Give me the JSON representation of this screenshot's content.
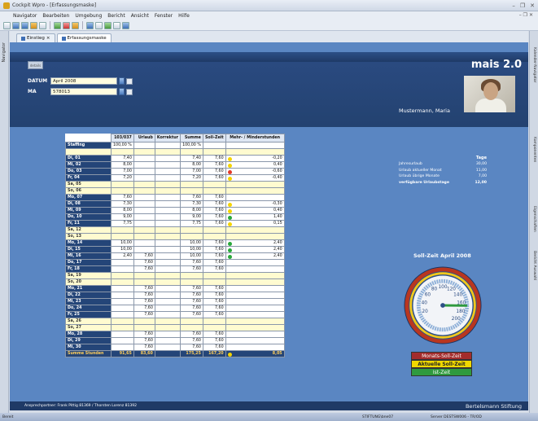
{
  "window": {
    "title": "Cockpit Wpro - [Erfassungsmaske]"
  },
  "menu": [
    "Navigator",
    "Bearbeiten",
    "Umgebung",
    "Bericht",
    "Ansicht",
    "Fenster",
    "Hilfe"
  ],
  "left_panel": {
    "label": "Navigator"
  },
  "right_panel": [
    "Kalender-Navigator",
    "Komponenten",
    "Eigenschaften",
    "Bericht Auswahl"
  ],
  "tabs": [
    {
      "label": "Einstieg"
    },
    {
      "label": "Erfassungsmaske"
    }
  ],
  "header": {
    "details_button": "details",
    "datum_label": "DATUM",
    "datum_value": "April 2008",
    "ma_label": "MA",
    "ma_value": "578013",
    "brand": "mais 2.0",
    "user_name": "Mustermann, Maria"
  },
  "table": {
    "columns": [
      "103/037",
      "Urlaub",
      "Korrektur",
      "Summe",
      "Soll-Zeit",
      "Mehr- / Minderstunden"
    ],
    "staffing": {
      "label": "Staffing",
      "c1": "100,00 %",
      "c4": "100,00 %"
    },
    "rows": [
      {
        "day": "Di, 01",
        "c1": "7,40",
        "c2": "",
        "c3": "",
        "c4": "7,40",
        "c5": "7,60",
        "status": "y",
        "c6": "-0,20",
        "we": false
      },
      {
        "day": "Mi, 02",
        "c1": "8,00",
        "c2": "",
        "c3": "",
        "c4": "8,00",
        "c5": "7,60",
        "status": "y",
        "c6": "0,40",
        "we": false
      },
      {
        "day": "Do, 03",
        "c1": "7,00",
        "c2": "",
        "c3": "",
        "c4": "7,00",
        "c5": "7,60",
        "status": "r",
        "c6": "-0,60",
        "we": false
      },
      {
        "day": "Fr, 04",
        "c1": "7,20",
        "c2": "",
        "c3": "",
        "c4": "7,20",
        "c5": "7,60",
        "status": "y",
        "c6": "-0,40",
        "we": false
      },
      {
        "day": "Sa, 05",
        "c1": "",
        "c2": "",
        "c3": "",
        "c4": "",
        "c5": "",
        "status": "",
        "c6": "",
        "we": true
      },
      {
        "day": "So, 06",
        "c1": "",
        "c2": "",
        "c3": "",
        "c4": "",
        "c5": "",
        "status": "",
        "c6": "",
        "we": true
      },
      {
        "day": "Mo, 07",
        "c1": "7,60",
        "c2": "",
        "c3": "",
        "c4": "7,60",
        "c5": "7,60",
        "status": "",
        "c6": "",
        "we": false
      },
      {
        "day": "Di, 08",
        "c1": "7,30",
        "c2": "",
        "c3": "",
        "c4": "7,30",
        "c5": "7,60",
        "status": "y",
        "c6": "-0,30",
        "we": false
      },
      {
        "day": "Mi, 09",
        "c1": "8,00",
        "c2": "",
        "c3": "",
        "c4": "8,00",
        "c5": "7,60",
        "status": "y",
        "c6": "0,40",
        "we": false
      },
      {
        "day": "Do, 10",
        "c1": "9,00",
        "c2": "",
        "c3": "",
        "c4": "9,00",
        "c5": "7,60",
        "status": "g",
        "c6": "1,40",
        "we": false
      },
      {
        "day": "Fr, 11",
        "c1": "7,75",
        "c2": "",
        "c3": "",
        "c4": "7,75",
        "c5": "7,60",
        "status": "y",
        "c6": "0,15",
        "we": false
      },
      {
        "day": "Sa, 12",
        "c1": "",
        "c2": "",
        "c3": "",
        "c4": "",
        "c5": "",
        "status": "",
        "c6": "",
        "we": true
      },
      {
        "day": "So, 13",
        "c1": "",
        "c2": "",
        "c3": "",
        "c4": "",
        "c5": "",
        "status": "",
        "c6": "",
        "we": true
      },
      {
        "day": "Mo, 14",
        "c1": "10,00",
        "c2": "",
        "c3": "",
        "c4": "10,00",
        "c5": "7,60",
        "status": "g",
        "c6": "2,40",
        "we": false
      },
      {
        "day": "Di, 15",
        "c1": "10,00",
        "c2": "",
        "c3": "",
        "c4": "10,00",
        "c5": "7,60",
        "status": "g",
        "c6": "2,40",
        "we": false
      },
      {
        "day": "Mi, 16",
        "c1": "2,40",
        "c2": "7,60",
        "c3": "",
        "c4": "10,00",
        "c5": "7,60",
        "status": "g",
        "c6": "2,40",
        "we": false
      },
      {
        "day": "Do, 17",
        "c1": "",
        "c2": "7,60",
        "c3": "",
        "c4": "7,60",
        "c5": "7,60",
        "status": "",
        "c6": "",
        "we": false
      },
      {
        "day": "Fr, 18",
        "c1": "",
        "c2": "7,60",
        "c3": "",
        "c4": "7,60",
        "c5": "7,60",
        "status": "",
        "c6": "",
        "we": false
      },
      {
        "day": "Sa, 19",
        "c1": "",
        "c2": "",
        "c3": "",
        "c4": "",
        "c5": "",
        "status": "",
        "c6": "",
        "we": true
      },
      {
        "day": "So, 20",
        "c1": "",
        "c2": "",
        "c3": "",
        "c4": "",
        "c5": "",
        "status": "",
        "c6": "",
        "we": true
      },
      {
        "day": "Mo, 21",
        "c1": "",
        "c2": "7,60",
        "c3": "",
        "c4": "7,60",
        "c5": "7,60",
        "status": "",
        "c6": "",
        "we": false
      },
      {
        "day": "Di, 22",
        "c1": "",
        "c2": "7,60",
        "c3": "",
        "c4": "7,60",
        "c5": "7,60",
        "status": "",
        "c6": "",
        "we": false
      },
      {
        "day": "Mi, 23",
        "c1": "",
        "c2": "7,60",
        "c3": "",
        "c4": "7,60",
        "c5": "7,60",
        "status": "",
        "c6": "",
        "we": false
      },
      {
        "day": "Do, 24",
        "c1": "",
        "c2": "7,60",
        "c3": "",
        "c4": "7,60",
        "c5": "7,60",
        "status": "",
        "c6": "",
        "we": false
      },
      {
        "day": "Fr, 25",
        "c1": "",
        "c2": "7,60",
        "c3": "",
        "c4": "7,60",
        "c5": "7,60",
        "status": "",
        "c6": "",
        "we": false
      },
      {
        "day": "Sa, 26",
        "c1": "",
        "c2": "",
        "c3": "",
        "c4": "",
        "c5": "",
        "status": "",
        "c6": "",
        "we": true
      },
      {
        "day": "So, 27",
        "c1": "",
        "c2": "",
        "c3": "",
        "c4": "",
        "c5": "",
        "status": "",
        "c6": "",
        "we": true
      },
      {
        "day": "Mo, 28",
        "c1": "",
        "c2": "7,60",
        "c3": "",
        "c4": "7,60",
        "c5": "7,60",
        "status": "",
        "c6": "",
        "we": false
      },
      {
        "day": "Di, 29",
        "c1": "",
        "c2": "7,60",
        "c3": "",
        "c4": "7,60",
        "c5": "7,60",
        "status": "",
        "c6": "",
        "we": false
      },
      {
        "day": "Mi, 30",
        "c1": "",
        "c2": "7,60",
        "c3": "",
        "c4": "7,60",
        "c5": "7,60",
        "status": "",
        "c6": "",
        "we": false
      }
    ],
    "sum": {
      "label": "Summe Stunden",
      "c1": "91,65",
      "c2": "83,60",
      "c3": "",
      "c4": "175,25",
      "c5": "167,20",
      "status": "y",
      "c6": "8,05"
    }
  },
  "vacation": {
    "header": "Tage",
    "rows": [
      {
        "label": "Jahresurlaub",
        "value": "30,00"
      },
      {
        "label": "Urlaub aktueller Monat",
        "value": "11,00"
      },
      {
        "label": "Urlaub übrige Monate",
        "value": "7,00"
      },
      {
        "label": "verfügbare Urlaubstage",
        "value": "12,00",
        "bold": true
      }
    ]
  },
  "gauge": {
    "title": "Soll-Zeit April 2008",
    "min": 0,
    "max": 200,
    "ticks": [
      "20",
      "40",
      "60",
      "80",
      "100",
      "120",
      "140",
      "160",
      "180",
      "200"
    ],
    "needle_value": 167.2
  },
  "legend": [
    "Monats-Soll-Zeit",
    "Aktuelle Soll-Zeit",
    "Ist-Zeit"
  ],
  "footer": {
    "contact": "Ansprechpartner: Frank Pittig 81369 / Thorsten Lorenz 81392",
    "brand": "Bertelsmann Stiftung"
  },
  "statusbar": {
    "left": "Bereit",
    "middle": "STIFTUNG\\bne07",
    "right": "Server DESTSW006 - TR/OD"
  }
}
